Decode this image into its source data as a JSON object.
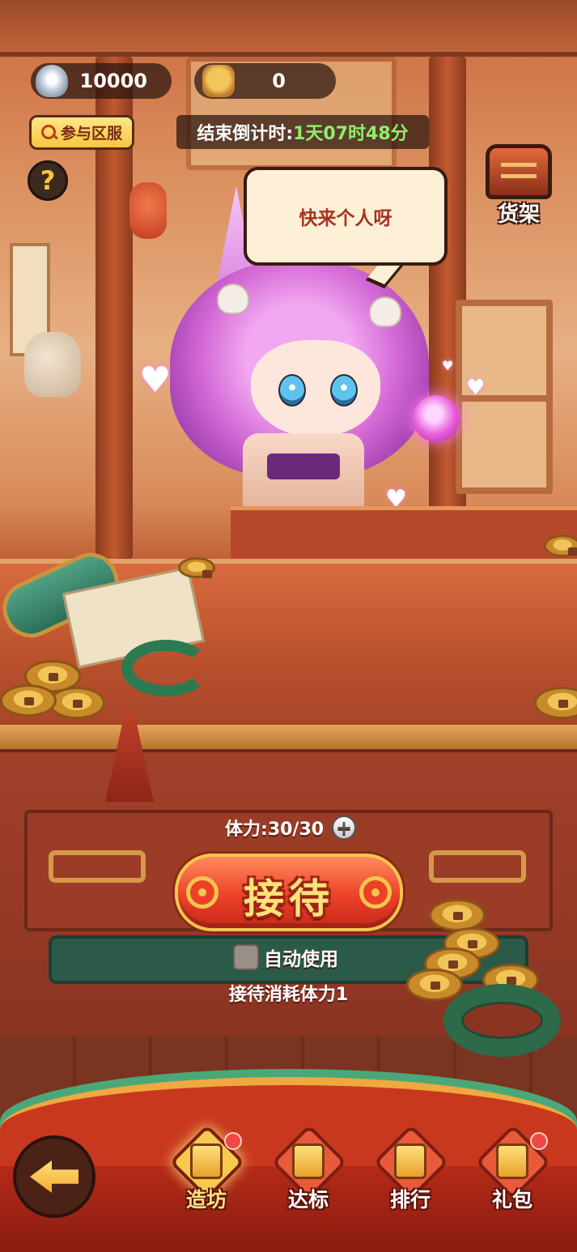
{
  "resources": {
    "silver": {
      "icon": "silver-ingot-icon",
      "value": "10000"
    },
    "token": {
      "icon": "token-bag-icon",
      "value": "0"
    }
  },
  "server_button": {
    "label": "参与区服",
    "icon": "search-icon"
  },
  "countdown": {
    "prefix": "结束倒计时:",
    "time": "1天07时48分"
  },
  "help_button": {
    "label": "?"
  },
  "shelf": {
    "label": "货架",
    "icon": "shelf-icon"
  },
  "speech": {
    "text": "快来个人呀"
  },
  "stamina": {
    "label": "体力:",
    "value": "30/30",
    "add": "+"
  },
  "reception": {
    "label": "接待"
  },
  "auto_use": {
    "label": "自动使用",
    "checked": false
  },
  "cost_note": "接待消耗体力1",
  "nav": {
    "back_icon": "back-arrow-icon",
    "items": [
      {
        "label": "造坊",
        "icon": "workshop-icon",
        "active": true,
        "badge": true
      },
      {
        "label": "达标",
        "icon": "achievement-icon",
        "active": false,
        "badge": false
      },
      {
        "label": "排行",
        "icon": "ranking-icon",
        "active": false,
        "badge": false
      },
      {
        "label": "礼包",
        "icon": "gift-icon",
        "active": false,
        "badge": true
      }
    ]
  },
  "colors": {
    "accent_green": "#8ef06a",
    "button_red": "#ec4128",
    "button_gold": "#f3c64e",
    "speech_text": "#a8321e"
  }
}
